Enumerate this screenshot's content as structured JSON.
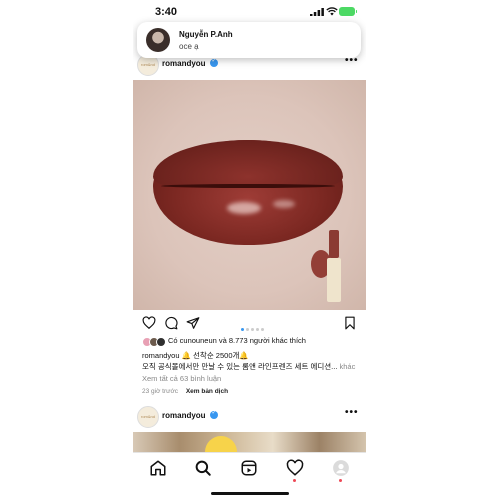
{
  "status_bar": {
    "time": "3:40"
  },
  "notification": {
    "sender": "Nguyễn P.Anh",
    "message": "oce ạ"
  },
  "post1": {
    "username": "romandyou",
    "logo_text": "rom&nd",
    "likes_text": "Có cunouneun và 8.773 người khác thích",
    "caption_line1": "romandyou 🔔 선착순 2500개🔔",
    "caption_line2": "오직 공식몰에서만 만날 수 있는 롬앤 라인프렌즈 세트 에디션...",
    "caption_more": "khác",
    "view_comments": "Xem tất cả 63 bình luận",
    "time_ago": "23 giờ trước",
    "see_translation": "Xem bản dịch",
    "carousel": {
      "count": 5,
      "active": 1
    }
  },
  "post2": {
    "username": "romandyou",
    "logo_text": "rom&nd"
  },
  "icons": {
    "like": "heart-icon",
    "comment": "comment-icon",
    "share": "send-icon",
    "save": "bookmark-icon",
    "home": "home-icon",
    "search": "search-icon",
    "reels": "reels-icon",
    "activity": "heart-icon",
    "profile": "profile-icon"
  },
  "colors": {
    "verified": "#3897f0",
    "battery": "#4cd964",
    "notification_dot": "#ed4956",
    "lipstick": "#7c2822"
  }
}
